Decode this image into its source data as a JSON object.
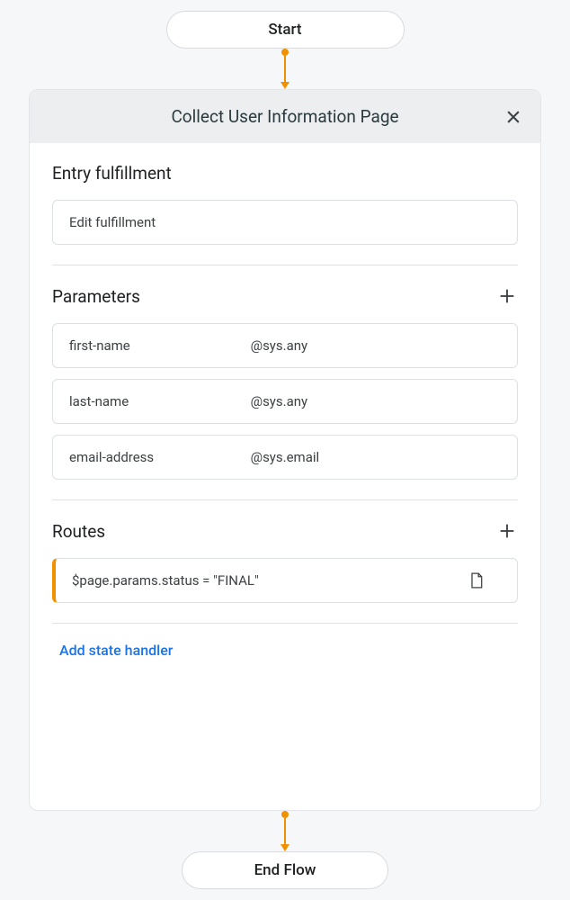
{
  "flow": {
    "start_label": "Start",
    "end_label": "End Flow"
  },
  "panel": {
    "title": "Collect User Information Page"
  },
  "entry_fulfillment": {
    "heading": "Entry fulfillment",
    "button_label": "Edit fulfillment"
  },
  "parameters": {
    "heading": "Parameters",
    "items": [
      {
        "name": "first-name",
        "type": "@sys.any"
      },
      {
        "name": "last-name",
        "type": "@sys.any"
      },
      {
        "name": "email-address",
        "type": "@sys.email"
      }
    ]
  },
  "routes": {
    "heading": "Routes",
    "items": [
      {
        "condition": "$page.params.status = \"FINAL\""
      }
    ]
  },
  "state_handler_label": "Add state handler"
}
